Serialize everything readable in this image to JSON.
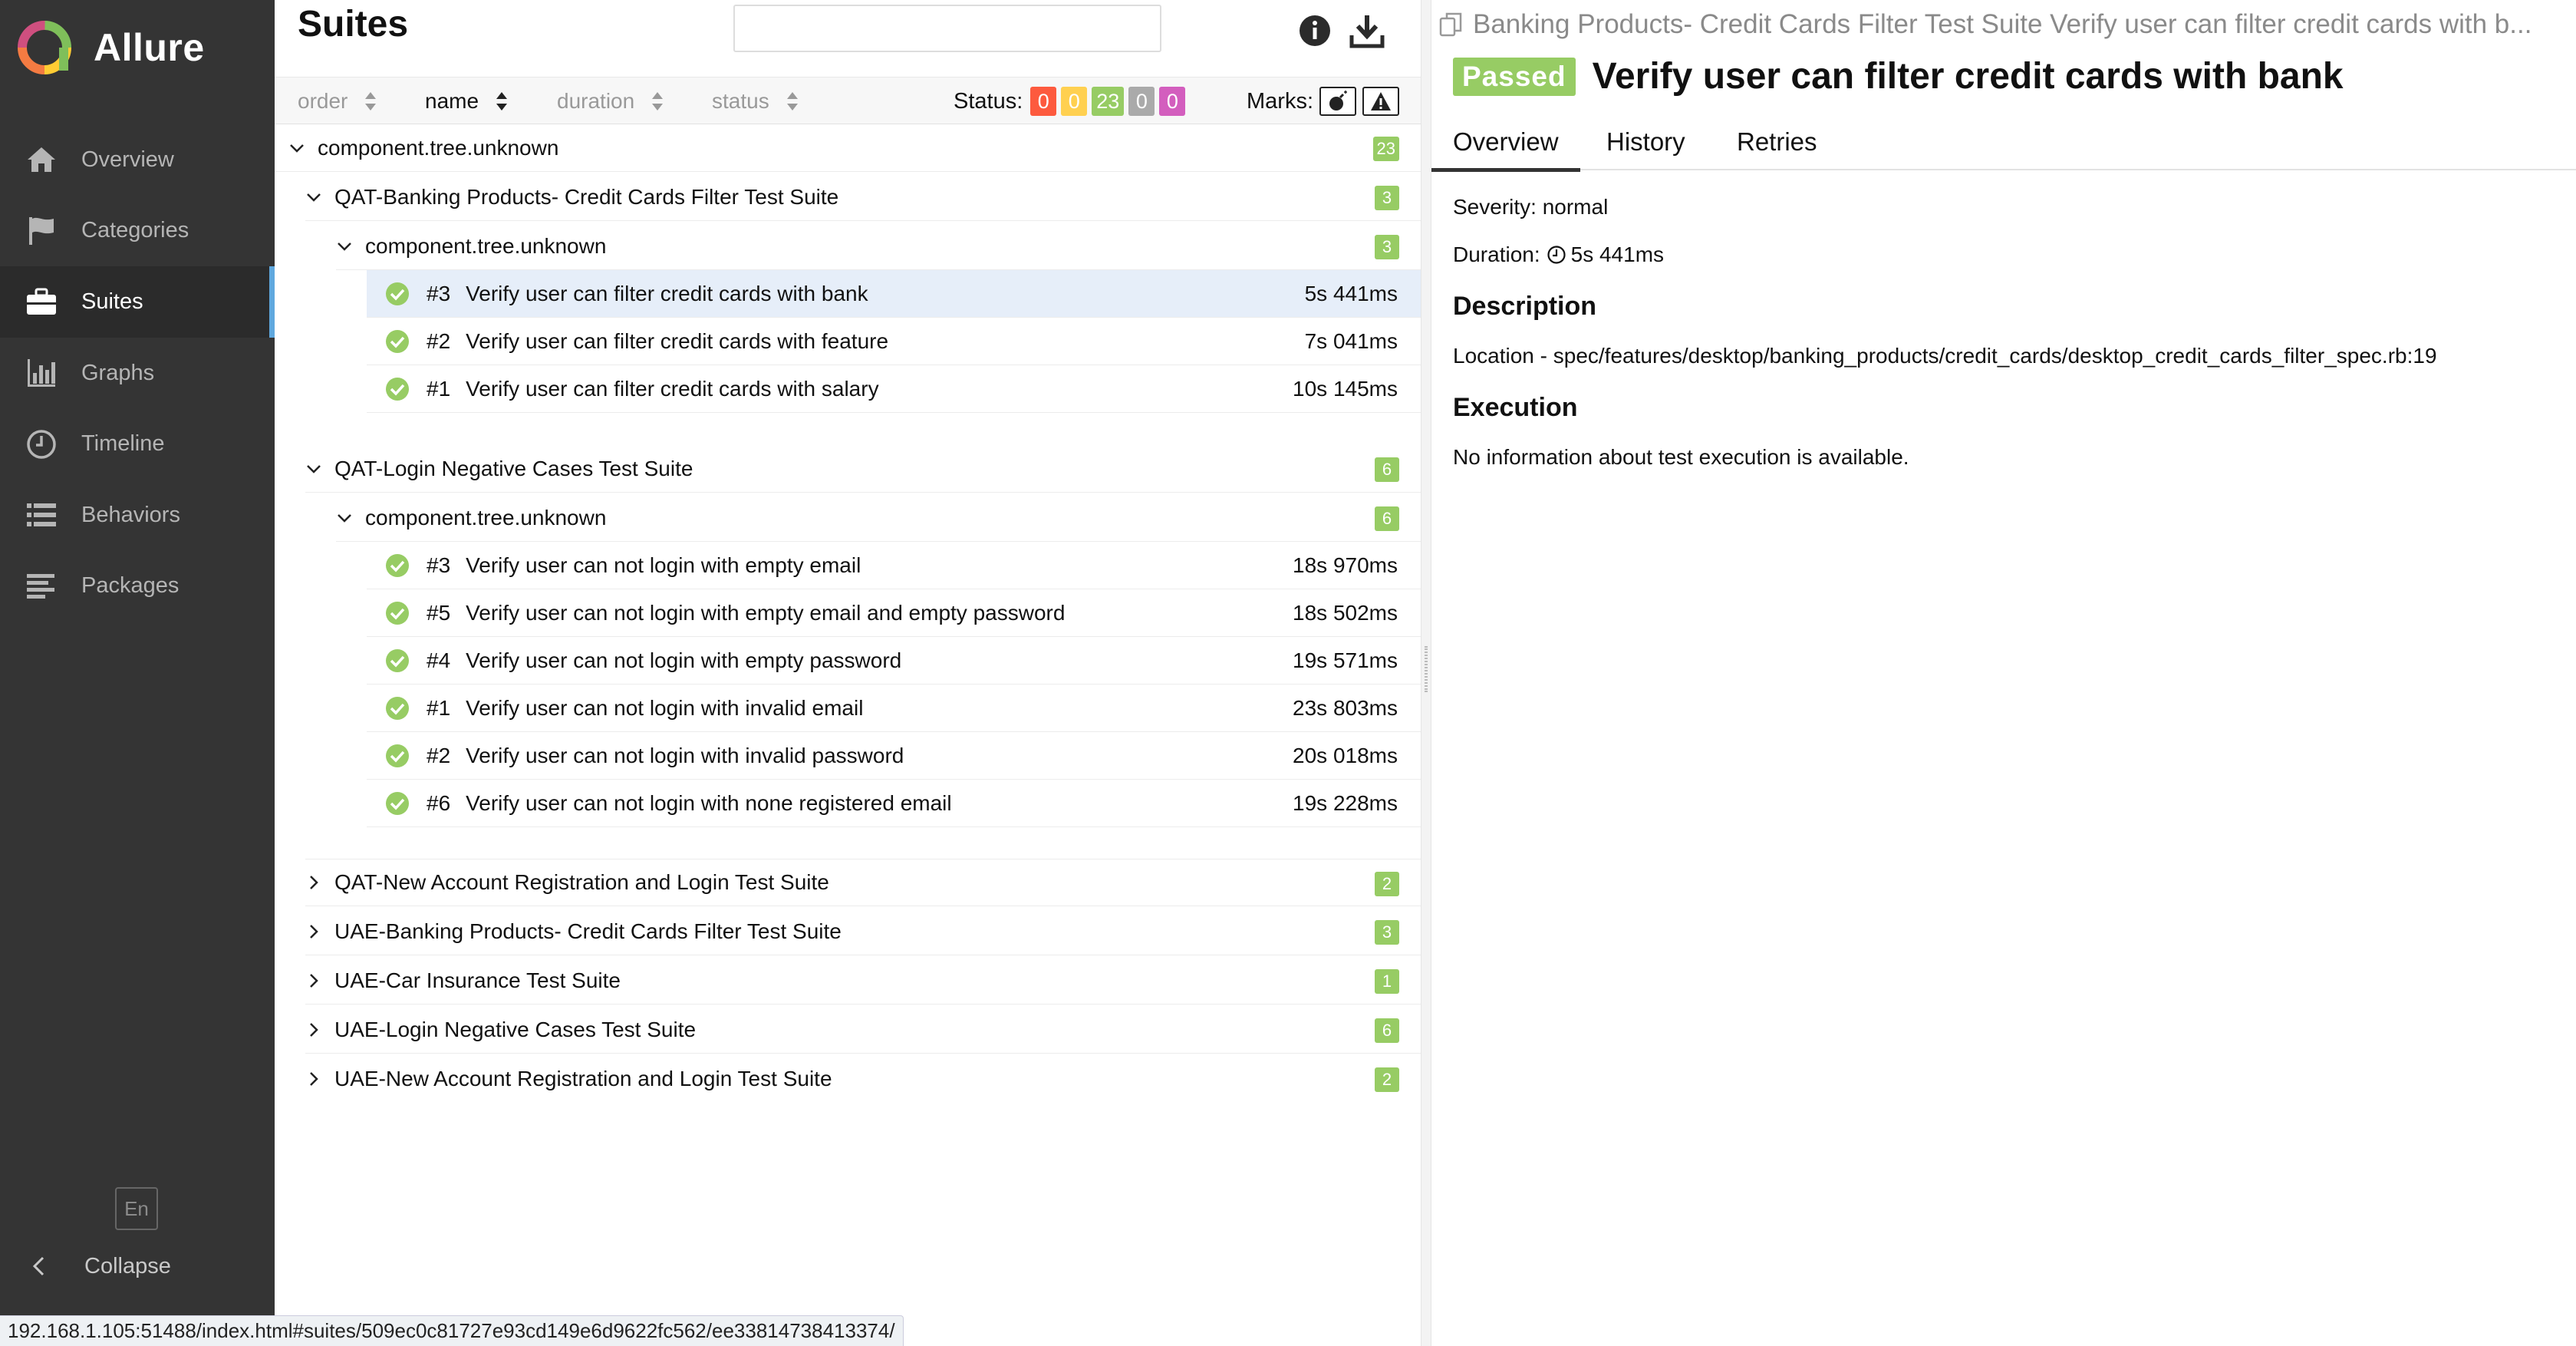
{
  "app": {
    "name": "Allure",
    "language": "En",
    "collapse_label": "Collapse"
  },
  "sidebar": {
    "items": [
      {
        "label": "Overview",
        "icon": "home-icon"
      },
      {
        "label": "Categories",
        "icon": "flag-icon"
      },
      {
        "label": "Suites",
        "icon": "briefcase-icon"
      },
      {
        "label": "Graphs",
        "icon": "bar-chart-icon"
      },
      {
        "label": "Timeline",
        "icon": "clock-icon"
      },
      {
        "label": "Behaviors",
        "icon": "list-icon"
      },
      {
        "label": "Packages",
        "icon": "align-left-icon"
      }
    ],
    "active": "Suites"
  },
  "suites_pane": {
    "title": "Suites",
    "search": {
      "value": "",
      "placeholder": ""
    },
    "sort": {
      "order": "order",
      "name": "name",
      "duration": "duration",
      "status": "status",
      "active": "name"
    },
    "status_filter": {
      "label": "Status:",
      "counts": [
        {
          "key": "failed",
          "value": "0",
          "color": "#fd5a3e"
        },
        {
          "key": "broken",
          "value": "0",
          "color": "#ffd050"
        },
        {
          "key": "passed",
          "value": "23",
          "color": "#97cc64"
        },
        {
          "key": "skipped",
          "value": "0",
          "color": "#aaaaaa"
        },
        {
          "key": "unknown",
          "value": "0",
          "color": "#d35ebe"
        }
      ]
    },
    "marks": {
      "label": "Marks:"
    },
    "root": {
      "name": "component.tree.unknown",
      "count": "23"
    },
    "suites": [
      {
        "name": "QAT-Banking Products- Credit Cards Filter Test Suite",
        "count": "3",
        "expanded": true,
        "group": {
          "name": "component.tree.unknown",
          "count": "3"
        },
        "tests": [
          {
            "order": "#3",
            "name": "Verify user can filter credit cards with bank",
            "duration": "5s 441ms",
            "selected": true
          },
          {
            "order": "#2",
            "name": "Verify user can filter credit cards with feature",
            "duration": "7s 041ms"
          },
          {
            "order": "#1",
            "name": "Verify user can filter credit cards with salary",
            "duration": "10s 145ms"
          }
        ]
      },
      {
        "name": "QAT-Login Negative Cases Test Suite",
        "count": "6",
        "expanded": true,
        "group": {
          "name": "component.tree.unknown",
          "count": "6"
        },
        "tests": [
          {
            "order": "#3",
            "name": "Verify user can not login with empty email",
            "duration": "18s 970ms"
          },
          {
            "order": "#5",
            "name": "Verify user can not login with empty email and empty password",
            "duration": "18s 502ms"
          },
          {
            "order": "#4",
            "name": "Verify user can not login with empty password",
            "duration": "19s 571ms"
          },
          {
            "order": "#1",
            "name": "Verify user can not login with invalid email",
            "duration": "23s 803ms"
          },
          {
            "order": "#2",
            "name": "Verify user can not login with invalid password",
            "duration": "20s 018ms"
          },
          {
            "order": "#6",
            "name": "Verify user can not login with none registered email",
            "duration": "19s 228ms"
          }
        ]
      },
      {
        "name": "QAT-New Account Registration and Login Test Suite",
        "count": "2",
        "expanded": false
      },
      {
        "name": "UAE-Banking Products- Credit Cards Filter Test Suite",
        "count": "3",
        "expanded": false
      },
      {
        "name": "UAE-Car Insurance Test Suite",
        "count": "1",
        "expanded": false
      },
      {
        "name": "UAE-Login Negative Cases Test Suite",
        "count": "6",
        "expanded": false
      },
      {
        "name": "UAE-New Account Registration and Login Test Suite",
        "count": "2",
        "expanded": false
      }
    ]
  },
  "detail": {
    "breadcrumb": "Banking Products- Credit Cards Filter Test Suite Verify user can filter credit cards with b...",
    "status": "Passed",
    "title": "Verify user can filter credit cards with bank",
    "tabs": [
      "Overview",
      "History",
      "Retries"
    ],
    "active_tab": "Overview",
    "severity": "Severity: normal",
    "duration_label": "Duration:",
    "duration_value": "5s 441ms",
    "description_heading": "Description",
    "description": "Location - spec/features/desktop/banking_products/credit_cards/desktop_credit_cards_filter_spec.rb:19",
    "execution_heading": "Execution",
    "execution": "No information about test execution is available."
  },
  "status_bar": {
    "url": "192.168.1.105:51488/index.html#suites/509ec0c81727e93cd149e6d9622fc562/ee33814738413374/"
  }
}
